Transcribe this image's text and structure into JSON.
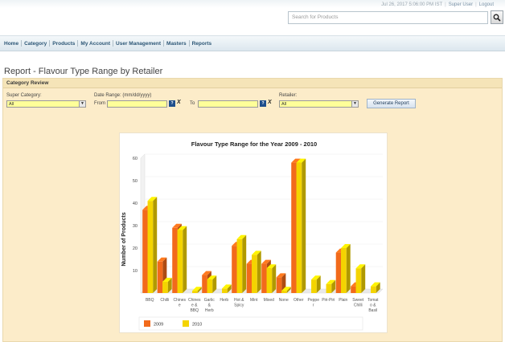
{
  "header": {
    "date_text": "Jul 26, 2017 5:06:00 PM IST",
    "user_name": "Super User",
    "logout_label": "Logout",
    "search_placeholder": "Search for Products"
  },
  "nav": {
    "items": [
      "Home",
      "Category",
      "Products",
      "My Account",
      "User Management",
      "Masters",
      "Reports"
    ]
  },
  "page": {
    "title": "Report - Flavour Type Range by Retailer",
    "panel_title": "Category Review"
  },
  "form": {
    "super_category_label": "Super Category:",
    "super_category_value": "All",
    "date_range_label": "Date Range: (mm/dd/yyyy)",
    "from_label": "From",
    "to_label": "To",
    "calendar_icon_text": "?",
    "clear_text": "X",
    "retailer_label": "Retailer:",
    "retailer_value": "All",
    "generate_label": "Generate Report"
  },
  "colors": {
    "series_2009": "#f26a1b",
    "series_2010": "#f4d400",
    "panel_bg": "#fcecc9",
    "nav_text": "#2c5676"
  },
  "chart_data": {
    "type": "bar",
    "title": "Flavour Type Range for the Year 2009 - 2010",
    "xlabel": "",
    "ylabel": "Number of Products",
    "ylim": [
      0,
      60
    ],
    "yticks": [
      10,
      20,
      30,
      40,
      50,
      60
    ],
    "categories": [
      [
        "BBQ"
      ],
      [
        "Chilli"
      ],
      [
        "Chines",
        "e"
      ],
      [
        "Chines",
        "e &",
        "BBQ"
      ],
      [
        "Garlic",
        "&",
        "Herb"
      ],
      [
        "Herb"
      ],
      [
        "Hot &",
        "Spicy"
      ],
      [
        "Mint"
      ],
      [
        "Mixed"
      ],
      [
        "None"
      ],
      [
        "Other"
      ],
      [
        "Peppe",
        "r"
      ],
      [
        "Piri-Piri"
      ],
      [
        "Plain"
      ],
      [
        "Sweet",
        "Chilli"
      ],
      [
        "Tomat",
        "o &",
        "Basil"
      ]
    ],
    "series": [
      {
        "name": "2009",
        "values": [
          37,
          14,
          29,
          0,
          8,
          0,
          21,
          13,
          13,
          7,
          58,
          0,
          0,
          18,
          3,
          0
        ]
      },
      {
        "name": "2010",
        "values": [
          41,
          5,
          28,
          1,
          6,
          2,
          24,
          17,
          11,
          1,
          58,
          6,
          4,
          20,
          11,
          3
        ]
      }
    ],
    "legend_position": "bottom-left",
    "grid": false
  }
}
